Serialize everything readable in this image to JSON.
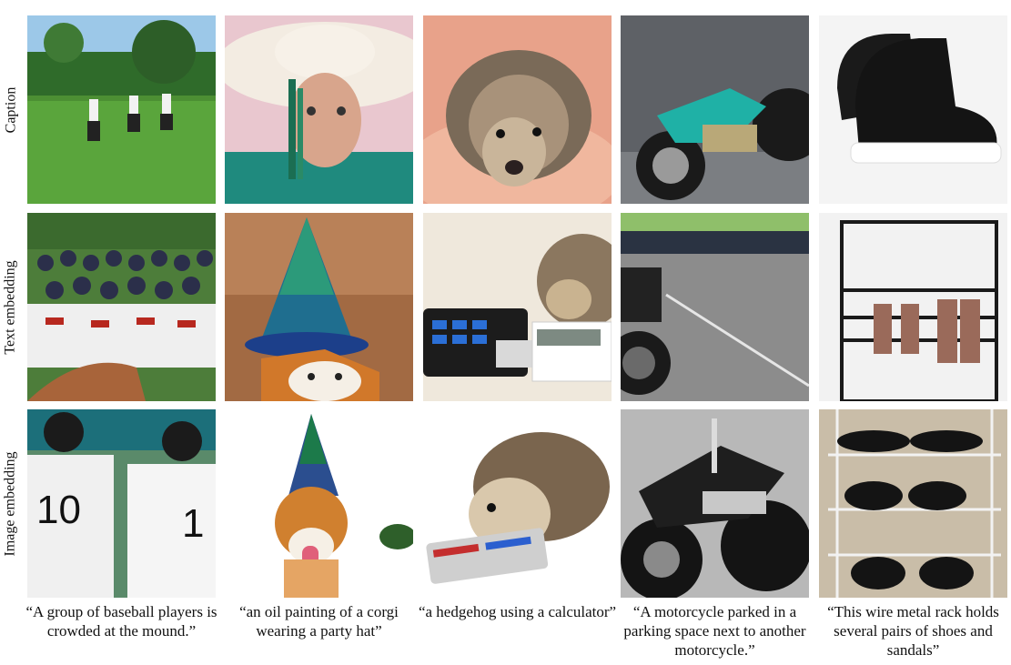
{
  "row_labels": [
    "Caption",
    "Text embedding",
    "Image embedding"
  ],
  "captions": [
    "“A group of baseball players is crowded at the mound.”",
    "“an oil painting of a corgi wearing a party hat”",
    "“a hedgehog using a calculator”",
    "“A motorcycle parked in a parking space next to another motorcycle.”",
    "“This wire metal rack holds several pairs of shoes and sandals”"
  ],
  "columns": [
    "baseball",
    "corgi",
    "hedgehog",
    "motorcycle",
    "shoes"
  ]
}
